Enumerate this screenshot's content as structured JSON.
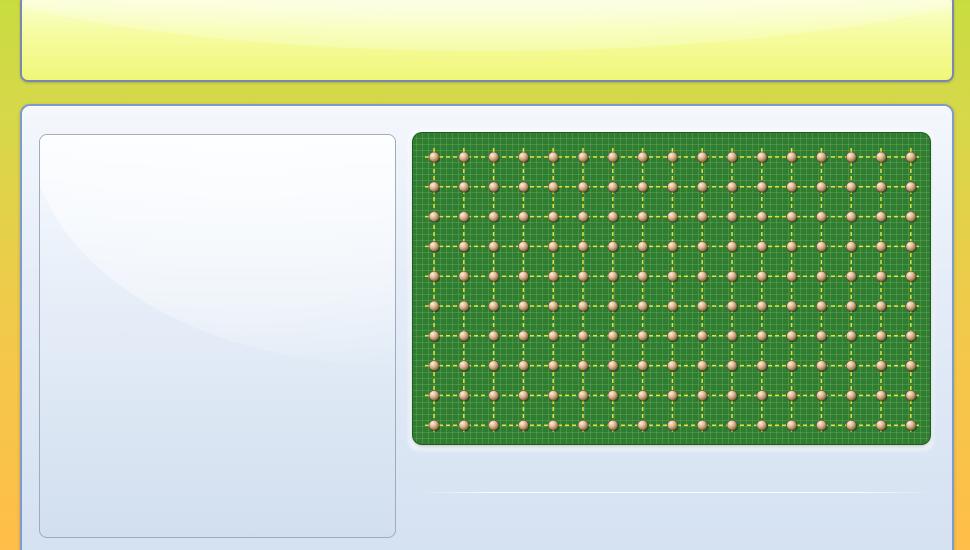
{
  "header": {
    "title": ""
  },
  "workspace": {
    "left_panel": {
      "label": ""
    },
    "geoboard": {
      "columns": 17,
      "rows": 10,
      "board_color": "#2f7d31",
      "grid_line_color": "#e7e13a",
      "peg_color": "#d8b38c",
      "peg_highlight": "#fff2dd",
      "minor_grid_color": "#b4dc96"
    }
  },
  "colors": {
    "app_background_top": "#c9dc3e",
    "app_background_bottom": "#ffbe49",
    "banner_fill": "#f6fca0",
    "panel_fill": "#e4ecf8",
    "panel_border": "#7f9bc9"
  }
}
